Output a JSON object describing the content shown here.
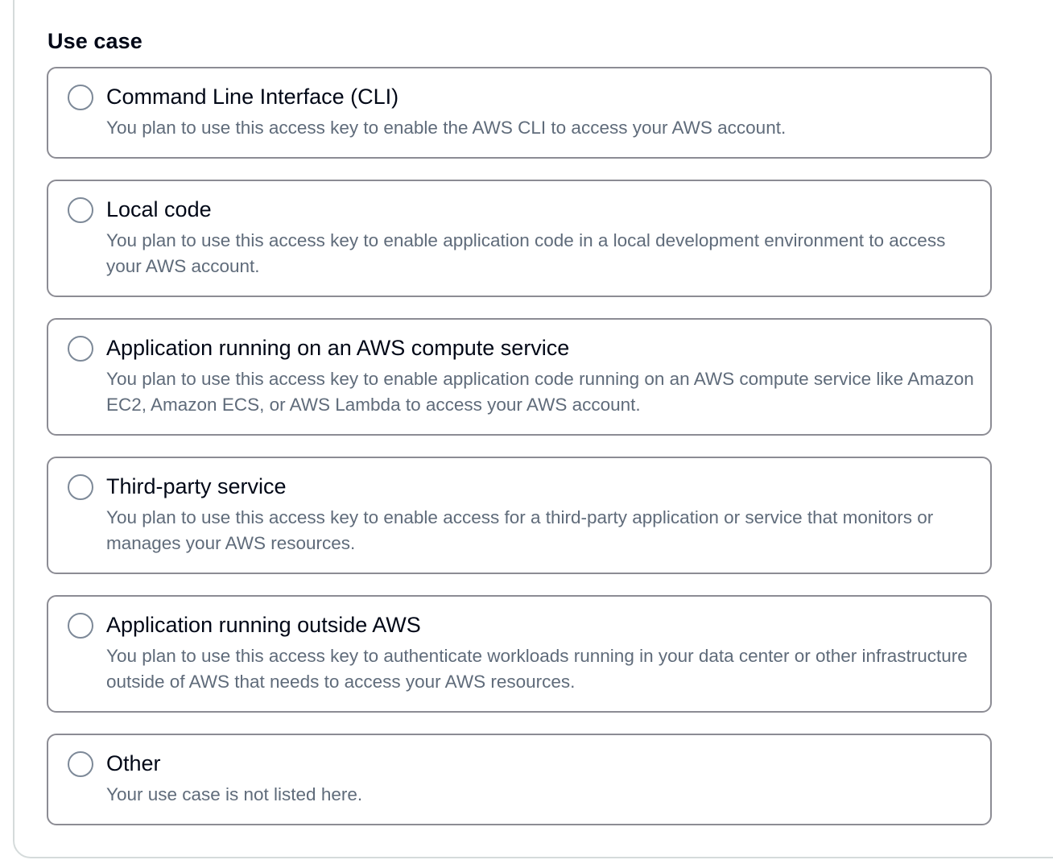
{
  "section": {
    "label": "Use case"
  },
  "options": [
    {
      "title": "Command Line Interface (CLI)",
      "description": "You plan to use this access key to enable the AWS CLI to access your AWS account.",
      "selected": false
    },
    {
      "title": "Local code",
      "description": "You plan to use this access key to enable application code in a local development environment to access your AWS account.",
      "selected": false
    },
    {
      "title": "Application running on an AWS compute service",
      "description": "You plan to use this access key to enable application code running on an AWS compute service like Amazon EC2, Amazon ECS, or AWS Lambda to access your AWS account.",
      "selected": false
    },
    {
      "title": "Third-party service",
      "description": "You plan to use this access key to enable access for a third-party application or service that monitors or manages your AWS resources.",
      "selected": false
    },
    {
      "title": "Application running outside AWS",
      "description": "You plan to use this access key to authenticate workloads running in your data center or other infrastructure outside of AWS that needs to access your AWS resources.",
      "selected": false
    },
    {
      "title": "Other",
      "description": "Your use case is not listed here.",
      "selected": false
    }
  ],
  "colors": {
    "tile_border": "#8c8c94",
    "title_text": "#000716",
    "description_text": "#5f6b7a",
    "radio_border": "#7d8998"
  }
}
